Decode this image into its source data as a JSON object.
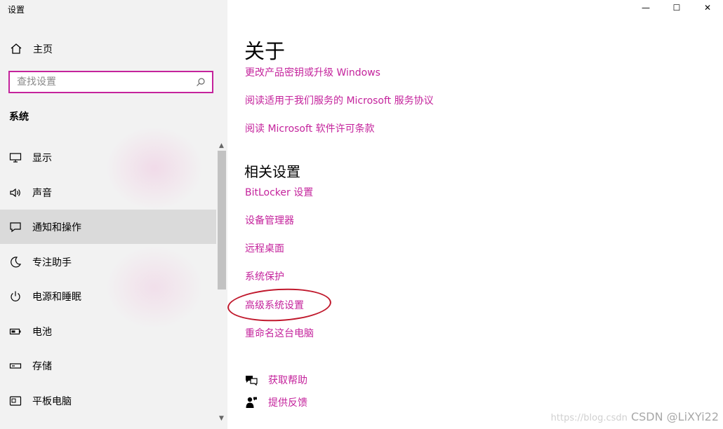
{
  "window": {
    "title": "设置",
    "controls": {
      "minimize": "—",
      "maximize": "☐",
      "close": "✕"
    }
  },
  "sidebar": {
    "home_label": "主页",
    "search_placeholder": "查找设置",
    "section_label": "系统",
    "items": [
      {
        "label": "显示",
        "icon": "monitor-icon",
        "active": false
      },
      {
        "label": "声音",
        "icon": "speaker-icon",
        "active": false
      },
      {
        "label": "通知和操作",
        "icon": "notification-icon",
        "active": true
      },
      {
        "label": "专注助手",
        "icon": "moon-icon",
        "active": false
      },
      {
        "label": "电源和睡眠",
        "icon": "power-icon",
        "active": false
      },
      {
        "label": "电池",
        "icon": "battery-icon",
        "active": false
      },
      {
        "label": "存储",
        "icon": "storage-icon",
        "active": false
      },
      {
        "label": "平板电脑",
        "icon": "tablet-icon",
        "active": false
      }
    ]
  },
  "main": {
    "about_heading": "关于",
    "about_links": [
      "更改产品密钥或升级 Windows",
      "阅读适用于我们服务的 Microsoft 服务协议",
      "阅读 Microsoft 软件许可条款"
    ],
    "related_heading": "相关设置",
    "related_links": [
      "BitLocker 设置",
      "设备管理器",
      "远程桌面",
      "系统保护",
      "高级系统设置",
      "重命名这台电脑"
    ],
    "help_links": [
      {
        "label": "获取帮助",
        "icon": "help-chat-icon"
      },
      {
        "label": "提供反馈",
        "icon": "feedback-icon"
      }
    ]
  },
  "watermark": {
    "faint": "https://blog.csdn",
    "text": "CSDN @LiXYi22"
  },
  "colors": {
    "accent": "#c4239c",
    "highlight_oval": "#c0182c",
    "sidebar_bg": "#f2f2f2",
    "active_item_bg": "#dadada"
  }
}
